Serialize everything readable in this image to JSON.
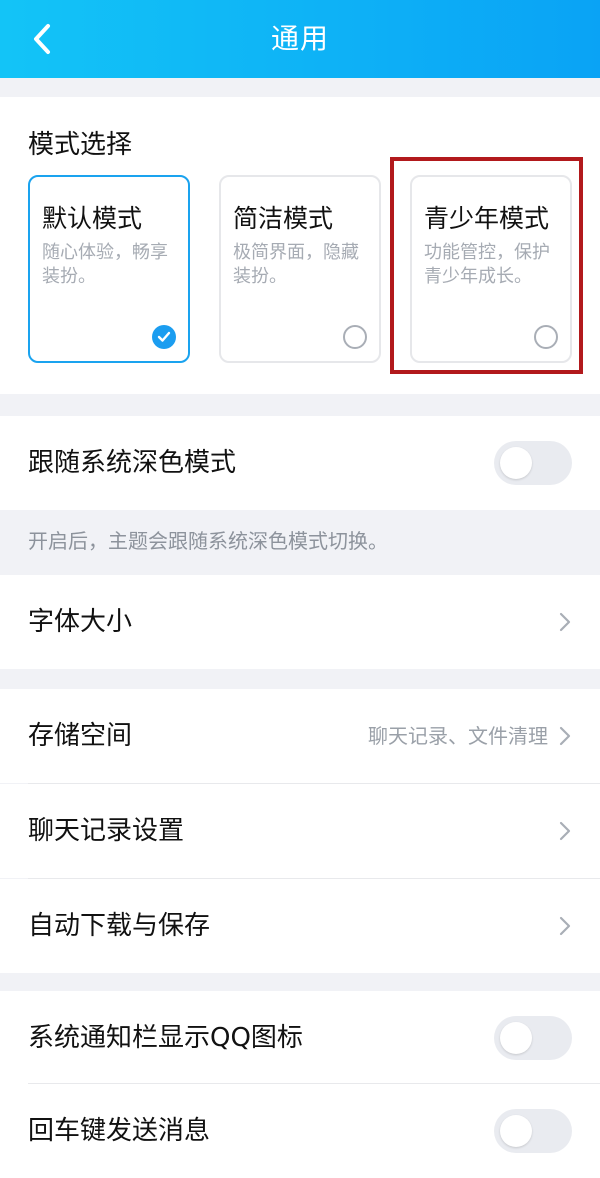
{
  "header": {
    "title": "通用",
    "back_icon": "chevron-left-icon"
  },
  "mode_selection": {
    "title": "模式选择",
    "modes": [
      {
        "name": "默认模式",
        "desc": "随心体验，畅享装扮。",
        "selected": true
      },
      {
        "name": "简洁模式",
        "desc": "极简界面，隐藏装扮。",
        "selected": false
      },
      {
        "name": "青少年模式",
        "desc": "功能管控，保护青少年成长。",
        "selected": false
      }
    ],
    "highlight_color": "#b2191c"
  },
  "dark_mode": {
    "label": "跟随系统深色模式",
    "enabled": false,
    "hint": "开启后，主题会跟随系统深色模式切换。"
  },
  "font_size": {
    "label": "字体大小"
  },
  "storage": {
    "label": "存储空间",
    "value": "聊天记录、文件清理"
  },
  "chat_history": {
    "label": "聊天记录设置"
  },
  "auto_download": {
    "label": "自动下载与保存"
  },
  "notification_icon": {
    "label": "系统通知栏显示QQ图标",
    "enabled": false
  },
  "enter_send": {
    "label": "回车键发送消息",
    "enabled": false
  },
  "colors": {
    "accent": "#1b9df0",
    "header_start": "#13c4f7",
    "header_end": "#0aa3f5"
  }
}
